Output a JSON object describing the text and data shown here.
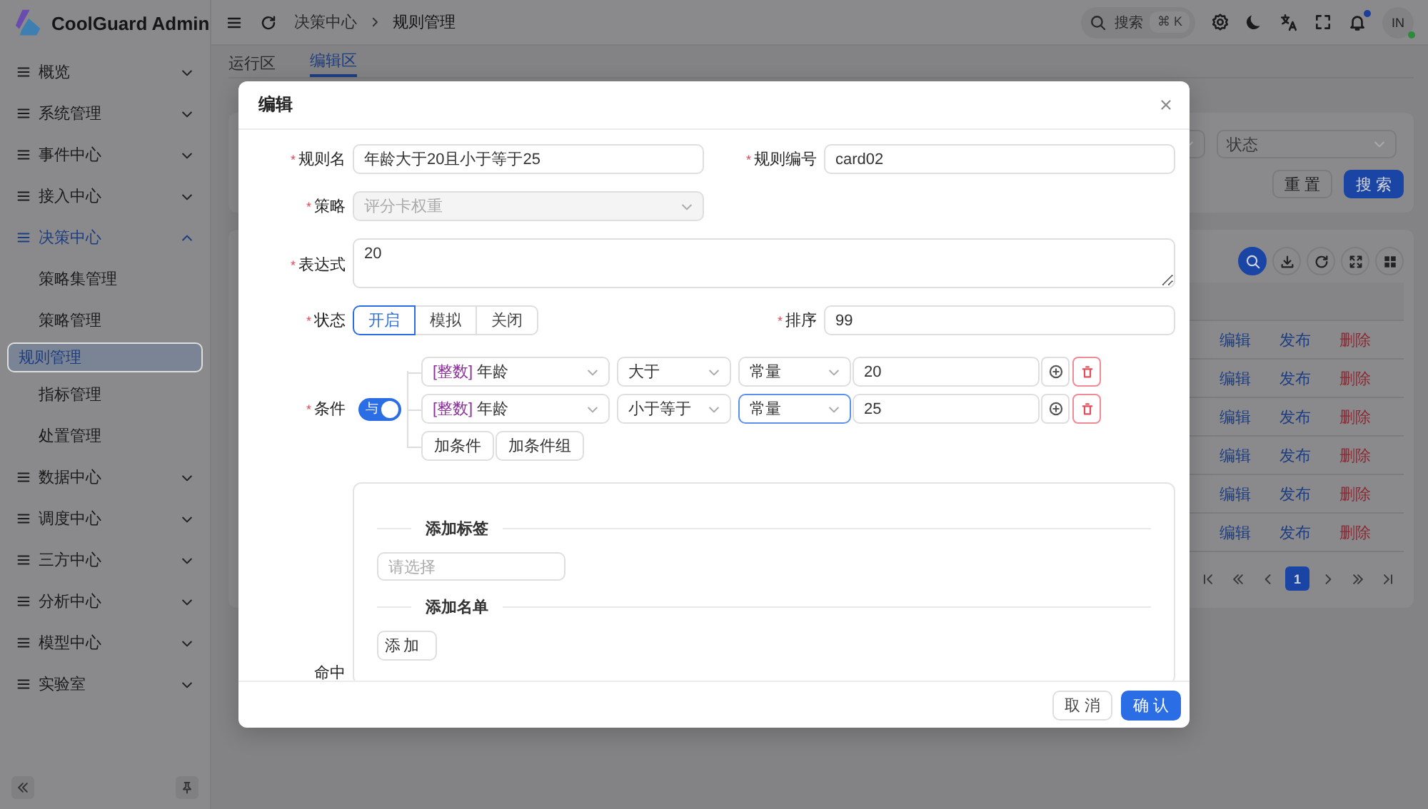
{
  "app": {
    "name": "CoolGuard Admin"
  },
  "sidebar": {
    "items": [
      {
        "label": "概览",
        "expanded": false
      },
      {
        "label": "系统管理",
        "expanded": false
      },
      {
        "label": "事件中心",
        "expanded": false
      },
      {
        "label": "接入中心",
        "expanded": false
      },
      {
        "label": "决策中心",
        "expanded": true,
        "children": [
          {
            "label": "策略集管理",
            "selected": false
          },
          {
            "label": "策略管理",
            "selected": false
          },
          {
            "label": "规则管理",
            "selected": true
          },
          {
            "label": "指标管理",
            "selected": false
          },
          {
            "label": "处置管理",
            "selected": false
          }
        ]
      },
      {
        "label": "数据中心",
        "expanded": false
      },
      {
        "label": "调度中心",
        "expanded": false
      },
      {
        "label": "三方中心",
        "expanded": false
      },
      {
        "label": "分析中心",
        "expanded": false
      },
      {
        "label": "模型中心",
        "expanded": false
      },
      {
        "label": "实验室",
        "expanded": false
      }
    ]
  },
  "topbar": {
    "breadcrumb": [
      "决策中心",
      "规则管理"
    ],
    "search": {
      "placeholder": "搜索",
      "shortcut": "⌘ K"
    },
    "notifications": {
      "unread": true
    },
    "avatar": {
      "initials": "IN",
      "online": true
    }
  },
  "tabs": [
    {
      "label": "运行区",
      "selected": false
    },
    {
      "label": "编辑区",
      "selected": true
    }
  ],
  "filter": {
    "status_select": {
      "placeholder": "状态"
    },
    "buttons": [
      {
        "label": "重置",
        "kind": "default"
      },
      {
        "label": "搜索",
        "kind": "primary"
      }
    ]
  },
  "table": {
    "rows": [
      {
        "actions": [
          {
            "label": "编辑",
            "kind": "link"
          },
          {
            "label": "发布",
            "kind": "link"
          },
          {
            "label": "删除",
            "kind": "danger"
          }
        ]
      },
      {
        "actions": [
          {
            "label": "编辑",
            "kind": "link"
          },
          {
            "label": "发布",
            "kind": "link"
          },
          {
            "label": "删除",
            "kind": "danger"
          }
        ]
      },
      {
        "actions": [
          {
            "label": "编辑",
            "kind": "link"
          },
          {
            "label": "发布",
            "kind": "link"
          },
          {
            "label": "删除",
            "kind": "danger"
          }
        ]
      },
      {
        "actions": [
          {
            "label": "编辑",
            "kind": "link"
          },
          {
            "label": "发布",
            "kind": "link"
          },
          {
            "label": "删除",
            "kind": "danger"
          }
        ]
      },
      {
        "actions": [
          {
            "label": "编辑",
            "kind": "link"
          },
          {
            "label": "发布",
            "kind": "link"
          },
          {
            "label": "删除",
            "kind": "danger"
          }
        ]
      },
      {
        "actions": [
          {
            "label": "编辑",
            "kind": "link"
          },
          {
            "label": "发布",
            "kind": "link"
          },
          {
            "label": "删除",
            "kind": "danger"
          }
        ]
      }
    ],
    "pagination": {
      "pages": [
        {
          "label": "1",
          "selected": true
        }
      ]
    }
  },
  "dialog": {
    "title": "编辑",
    "rule_name": {
      "label": "规则名",
      "required_mark": "*",
      "value": "年龄大于20且小于等于25"
    },
    "rule_code": {
      "label": "规则编号",
      "required_mark": "*",
      "value": "card02"
    },
    "strategy": {
      "label": "策略",
      "required_mark": "*",
      "value": "评分卡权重",
      "disabled": true
    },
    "expression": {
      "label": "表达式",
      "required_mark": "*",
      "value": "20"
    },
    "status": {
      "label": "状态",
      "required_mark": "*",
      "options": [
        {
          "label": "开启",
          "selected": true
        },
        {
          "label": "模拟",
          "selected": false
        },
        {
          "label": "关闭",
          "selected": false
        }
      ]
    },
    "order": {
      "label": "排序",
      "required_mark": "*",
      "value": "99"
    },
    "conditions": {
      "label": "条件",
      "required_mark": "*",
      "logic": {
        "label": "与",
        "on": true
      },
      "rows": [
        {
          "type_tag": "[整数]",
          "field": "年龄",
          "operator": "大于",
          "value_type": "常量",
          "focused": false,
          "value": "20"
        },
        {
          "type_tag": "[整数]",
          "field": "年龄",
          "operator": "小于等于",
          "value_type": "常量",
          "focused": true,
          "value": "25"
        }
      ],
      "buttons": [
        "加条件",
        "加条件组"
      ]
    },
    "hit": {
      "label": "命中",
      "sections": [
        {
          "title": "添加标签",
          "control": {
            "kind": "select",
            "placeholder": "请选择"
          }
        },
        {
          "title": "添加名单",
          "control": {
            "kind": "button",
            "label": "添加"
          }
        }
      ]
    },
    "footer": [
      {
        "label": "取消",
        "kind": "default"
      },
      {
        "label": "确认",
        "kind": "primary"
      }
    ]
  }
}
